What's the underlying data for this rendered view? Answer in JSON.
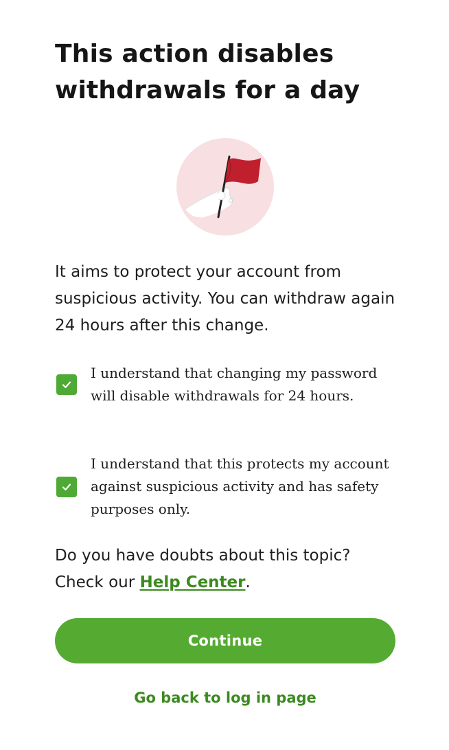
{
  "title": "This action disables withdrawals for a day",
  "illustration": {
    "icon": "red-flag-in-hand-icon",
    "circle_color": "#f8dfe1",
    "flag_color": "#c0202e"
  },
  "intro": "It aims to protect your account from suspicious activity. You can withdraw again 24 hours after this change.",
  "checkboxes": [
    {
      "label": "I understand that changing my password will disable withdrawals for 24 hours.",
      "checked": true
    },
    {
      "label": "I understand that this protects my account against suspicious activity and has safety purposes only.",
      "checked": true
    }
  ],
  "help": {
    "line1": "Do you have doubts about this topic?",
    "prefix": "Check our ",
    "link_label": "Help Center",
    "suffix": "."
  },
  "continue_label": "Continue",
  "back_link_label": "Go back to log in page",
  "colors": {
    "accent": "#55ab32",
    "link": "#3c8a1f",
    "text": "#1e1e1e"
  }
}
